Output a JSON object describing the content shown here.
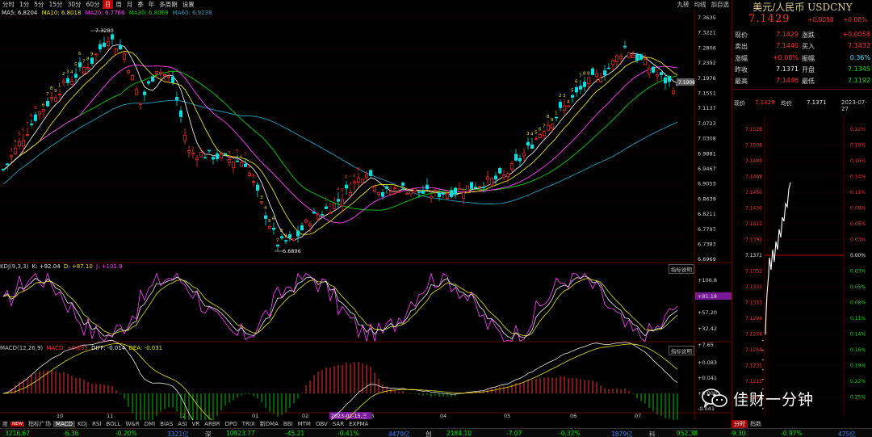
{
  "toolbar": {
    "left_items": [
      "分时",
      "1分",
      "5分",
      "15分",
      "30分",
      "60分",
      "日",
      "周",
      "月",
      "季",
      "年",
      "多周期",
      "设置"
    ],
    "active_index": 6,
    "right_items": [
      "九转",
      "均线",
      "加自选"
    ]
  },
  "ma_legend": {
    "ma5": "MA5: 6.8204",
    "ma10": "MA10: 6.8018",
    "ma20": "MA20: 6.7766",
    "ma30": "MA30: 6.8069",
    "ma60": "MA60: 6.9238"
  },
  "colors": {
    "up": "#ff3030",
    "down": "#00e0e0",
    "ma5": "#e8e8e8",
    "ma10": "#e8e000",
    "ma20": "#ff40ff",
    "ma30": "#00d000",
    "ma60": "#20a0c0",
    "bg": "#000000",
    "grid": "#3a0000",
    "kdj_k": "#e8e8e8",
    "kdj_d": "#e8e000",
    "kdj_j": "#ff40ff"
  },
  "main_chart": {
    "y_ticks": [
      "7.3635",
      "7.3221",
      "7.2806",
      "7.2392",
      "7.1976",
      "7.1551",
      "7.1137",
      "7.0723",
      "7.0308",
      "6.9881",
      "6.9467",
      "6.9053",
      "6.8639",
      "6.8211",
      "6.7797",
      "6.7383",
      "6.6969"
    ],
    "high_label": "7.3280",
    "low_label": "6.6896",
    "last_tag": "7.1908",
    "month_labels": [
      "10",
      "11",
      "12",
      "01",
      "02",
      "03",
      "04",
      "05",
      "06",
      "07"
    ],
    "date_highlight": "2023-02-15,三",
    "nine_turn_marks": [
      "9",
      "8",
      "7",
      "6",
      "5",
      "4",
      "3",
      "2",
      "1"
    ]
  },
  "kdj": {
    "title": "KDJ(9,3,3)",
    "k": "K: +92.04",
    "d": "D: +87.10",
    "j": "J: +101.9",
    "button": "指标说明",
    "y_ticks": [
      "+106.8",
      "+81.18",
      "+57.20",
      "+32.42",
      "+7.65"
    ]
  },
  "macd": {
    "title": "MACD(12,26,9)",
    "macd": "MACD: +0.035",
    "diff": "DIFF: -0.014",
    "dea": "DEA: -0.031",
    "button": "指标说明",
    "y_ticks": [
      "+0.083",
      "+0.041",
      "+0.000",
      "-0.041"
    ]
  },
  "bottom_tabs": [
    "指标广场",
    "MACD",
    "KDJ",
    "RSI",
    "BOLL",
    "W&R",
    "DMI",
    "BIAS",
    "ASI",
    "VR",
    "ARBR",
    "DPO",
    "TRIX",
    "新DMA",
    "BBI",
    "MTM",
    "OBV",
    "SAR",
    "EXPMA"
  ],
  "bottom_tabs_active": 1,
  "bottom_prefix": "度",
  "new_badge": "NEW",
  "quote": {
    "title": "美元/人民币 USDCNY",
    "price": "7.1429",
    "change": "+0.0058",
    "change_pct": "+0.08%",
    "rows": [
      {
        "k1": "现价",
        "v1": "7.1429",
        "k2": "涨跌",
        "v2": "+0.0058"
      },
      {
        "k1": "卖出",
        "v1": "7.1440",
        "k2": "买入",
        "v2": "7.1432"
      },
      {
        "k1": "涨幅",
        "v1": "+0.08%",
        "k2": "振幅",
        "v2": "0.36%"
      },
      {
        "k1": "昨收",
        "v1": "7.1371",
        "k2": "开盘",
        "v2": "7.1345"
      },
      {
        "k1": "最高",
        "v1": "7.1446",
        "k2": "最低",
        "v2": "7.1192"
      }
    ],
    "mini_header": {
      "k1": "现价",
      "v1": "7.1429",
      "k2": "均价",
      "v2": "7.1371",
      "date": "2023-07-27"
    },
    "mini_y_left": [
      "7.1528",
      "7.1509",
      "7.1489",
      "7.1469",
      "7.1450",
      "7.1430",
      "7.1411",
      "7.1392",
      "7.1371",
      "7.1352",
      "7.1333",
      "7.1313",
      "7.1294",
      "7.1274",
      "7.1254",
      "7.1235",
      "7.1215",
      "7.1195"
    ],
    "mini_y_right": [
      "0.22%",
      "0.19%",
      "0.16%",
      "0.14%",
      "0.11%",
      "0.08%",
      "0.05%",
      "0.03%",
      "0.00%",
      "0.03%",
      "0.05%",
      "0.08%",
      "0.11%",
      "0.14%",
      "0.16%",
      "0.19%",
      "0.22%",
      "0.25%"
    ],
    "tabs": [
      "分时",
      "指数"
    ]
  },
  "status_bar": {
    "items": [
      {
        "text": "3216.67",
        "color": "#00e000"
      },
      {
        "text": "-6.36",
        "color": "#00e000"
      },
      {
        "text": "-0.20%",
        "color": "#00e000"
      },
      {
        "text": "3321亿",
        "color": "#4080ff"
      },
      {
        "text": "深",
        "color": "#c0c0c0"
      },
      {
        "text": "10923.77",
        "color": "#00e000"
      },
      {
        "text": "-45.21",
        "color": "#00e000"
      },
      {
        "text": "-0.41%",
        "color": "#00e000"
      },
      {
        "text": "4479亿",
        "color": "#4080ff"
      },
      {
        "text": "创",
        "color": "#c0c0c0"
      },
      {
        "text": "2184.10",
        "color": "#00e000"
      },
      {
        "text": "-7.07",
        "color": "#00e000"
      },
      {
        "text": "-0.32%",
        "color": "#00e000"
      },
      {
        "text": "1879亿",
        "color": "#4080ff"
      },
      {
        "text": "科",
        "color": "#c0c0c0"
      },
      {
        "text": "952.38",
        "color": "#00e000"
      },
      {
        "text": "-9.30",
        "color": "#00e000"
      },
      {
        "text": "-0.97%",
        "color": "#00e000"
      },
      {
        "text": "475亿",
        "color": "#4080ff"
      }
    ]
  },
  "watermark": {
    "text": "佳财一分钟",
    "icon": "wechat-icon"
  }
}
